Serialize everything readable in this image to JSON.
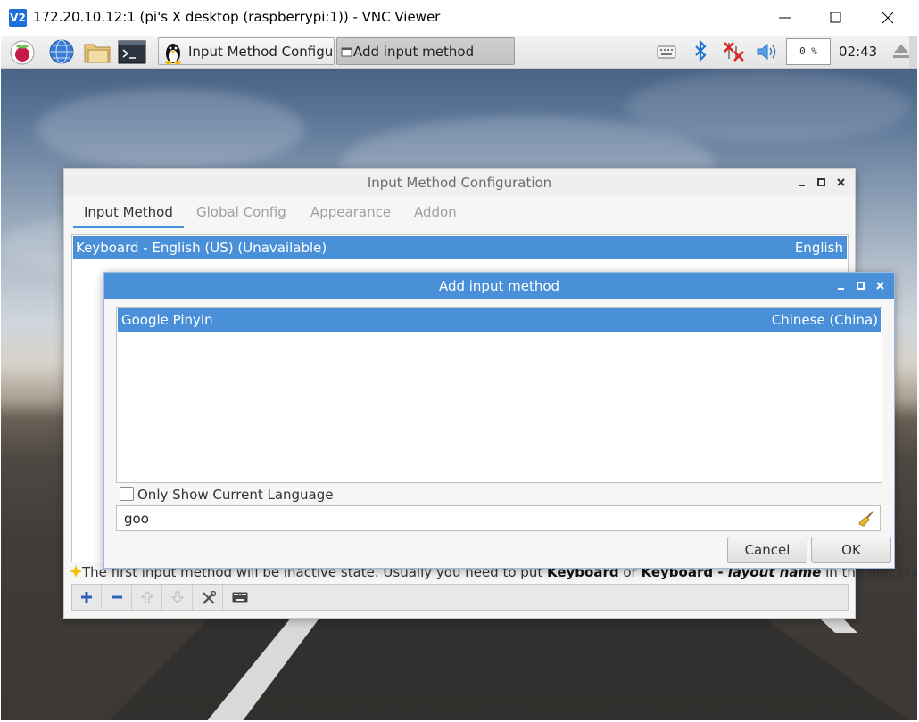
{
  "vnc": {
    "logo": "V2",
    "title": "172.20.10.12:1 (pi's X desktop (raspberrypi:1)) - VNC Viewer"
  },
  "panel": {
    "tasks": [
      {
        "label": "Input Method Configu...",
        "icon": "tux-icon"
      },
      {
        "label": "Add input method",
        "icon": "window-icon"
      }
    ],
    "cpu_usage": "0 %",
    "clock": "02:43"
  },
  "imc": {
    "title": "Input Method Configuration",
    "tabs": [
      "Input Method",
      "Global Config",
      "Appearance",
      "Addon"
    ],
    "active_tab": "Input Method",
    "rows": [
      {
        "name": "Keyboard - English (US) (Unavailable)",
        "language": "English"
      }
    ],
    "hint": {
      "before": "The first input method will be inactive state. Usually you need to put ",
      "kw1": "Keyboard",
      "mid": " or ",
      "kw2": "Keyboard - ",
      "kw3": "layout name",
      "after": " in the first place."
    }
  },
  "aim": {
    "title": "Add input method",
    "rows": [
      {
        "name": "Google Pinyin",
        "language": "Chinese (China)"
      }
    ],
    "only_current_label": "Only Show Current Language",
    "only_current_checked": false,
    "search_value": "goo",
    "cancel_label": "Cancel",
    "ok_label": "OK"
  },
  "colors": {
    "selection": "#4a90d9",
    "tab_indicator": "#4a90d9"
  }
}
